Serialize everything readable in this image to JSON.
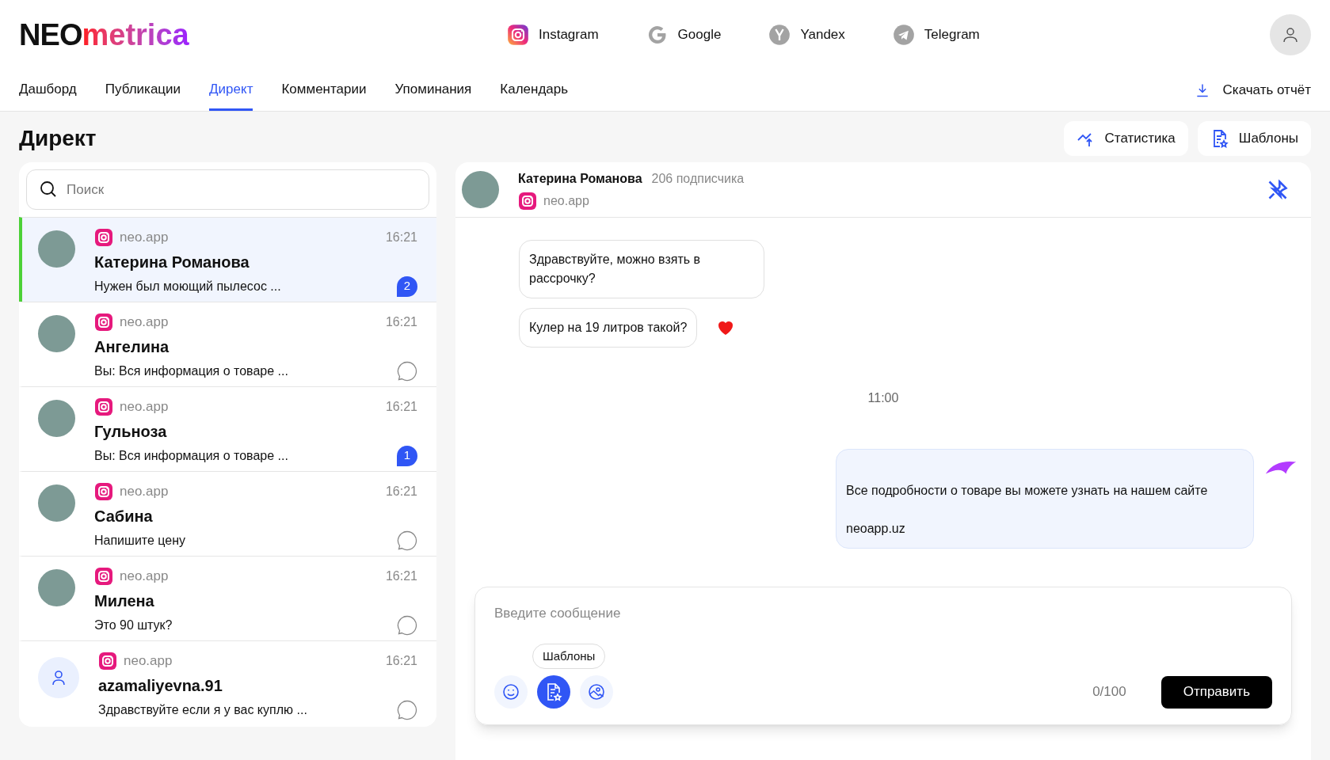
{
  "logo": {
    "part1": "NEO",
    "part2": "metrica"
  },
  "platforms": [
    {
      "kind": "instagram",
      "label": "Instagram"
    },
    {
      "kind": "google",
      "label": "Google"
    },
    {
      "kind": "yandex",
      "label": "Yandex"
    },
    {
      "kind": "telegram",
      "label": "Telegram"
    }
  ],
  "nav": {
    "tabs": [
      {
        "label": "Дашборд",
        "selected": false
      },
      {
        "label": "Публикации",
        "selected": false
      },
      {
        "label": "Директ",
        "selected": true
      },
      {
        "label": "Комментарии",
        "selected": false
      },
      {
        "label": "Упоминания",
        "selected": false
      },
      {
        "label": "Календарь",
        "selected": false
      }
    ],
    "download": "Скачать отчёт"
  },
  "page": {
    "title": "Директ",
    "actions": [
      {
        "kind": "stats",
        "label": "Статистика"
      },
      {
        "kind": "templates",
        "label": "Шаблоны"
      }
    ]
  },
  "search": {
    "placeholder": "Поиск"
  },
  "conversations": [
    {
      "account": "neo.app",
      "time": "16:21",
      "name": "Катерина Романова",
      "preview": "Нужен был моющий пылесос ...",
      "unread": "2",
      "selected": true,
      "kind": "photo"
    },
    {
      "account": "neo.app",
      "time": "16:21",
      "name": "Ангелина",
      "preview": "Вы: Вся информация о товаре ...",
      "selected": false,
      "kind": "photo"
    },
    {
      "account": "neo.app",
      "time": "16:21",
      "name": "Гульноза",
      "preview": "Вы: Вся информация о товаре ...",
      "unread": "1",
      "selected": false,
      "kind": "photo"
    },
    {
      "account": "neo.app",
      "time": "16:21",
      "name": "Сабина",
      "preview": "Напишите цену",
      "selected": false,
      "kind": "photo"
    },
    {
      "account": "neo.app",
      "time": "16:21",
      "name": "Милена",
      "preview": "Это 90 штук?",
      "selected": false,
      "kind": "photo"
    },
    {
      "account": "neo.app",
      "time": "16:21",
      "name": "azamaliyevna.91",
      "preview": "Здравствуйте если я у вас куплю ...",
      "selected": false,
      "kind": "default"
    }
  ],
  "chat": {
    "name": "Катерина Романова",
    "followers": "206 подписчика",
    "account": "neo.app",
    "messages": [
      {
        "kind": "incoming",
        "text": "Здравствуйте, можно взять в рассрочку?",
        "liked": false
      },
      {
        "kind": "incoming",
        "text": "Кулер на 19 литров такой?",
        "liked": true
      },
      {
        "kind": "time",
        "text": "11:00"
      },
      {
        "kind": "outgoing",
        "lines": [
          "Все подробности о товаре вы можете узнать на нашем сайте",
          "neoapp.uz"
        ]
      }
    ],
    "composer": {
      "placeholder": "Введите сообщение",
      "tooltip": "Шаблоны",
      "counter": "0/100",
      "send": "Отправить",
      "tools": [
        {
          "kind": "emoji",
          "selected": false
        },
        {
          "kind": "templates",
          "selected": true
        },
        {
          "kind": "image",
          "selected": false
        }
      ]
    }
  }
}
